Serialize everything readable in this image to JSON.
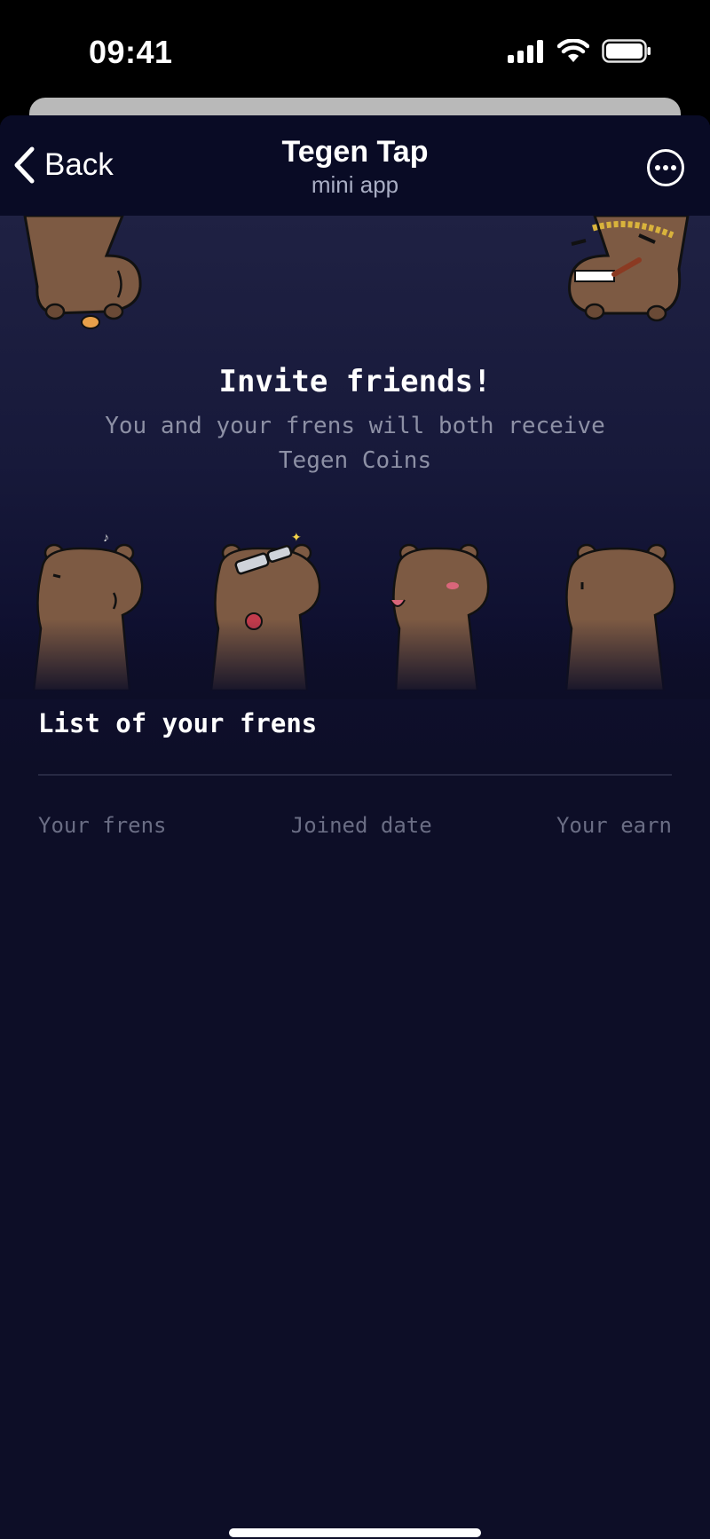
{
  "status_bar": {
    "time": "09:41",
    "icons": [
      "cellular-signal-icon",
      "wifi-icon",
      "battery-icon"
    ]
  },
  "header": {
    "back_label": "Back",
    "title": "Tegen Tap",
    "subtitle": "mini app",
    "more_icon": "more-options-icon"
  },
  "invite": {
    "title": "Invite friends!",
    "description": "You and your frens will both receive Tegen Coins"
  },
  "friends": {
    "heading": "List of your frens",
    "columns": [
      "Your frens",
      "Joined date",
      "Your earn"
    ],
    "rows": []
  },
  "colors": {
    "background": "#0d0e27",
    "header": "#090b25",
    "capybara": "#7d5a43",
    "muted_text": "#8d90a5"
  }
}
